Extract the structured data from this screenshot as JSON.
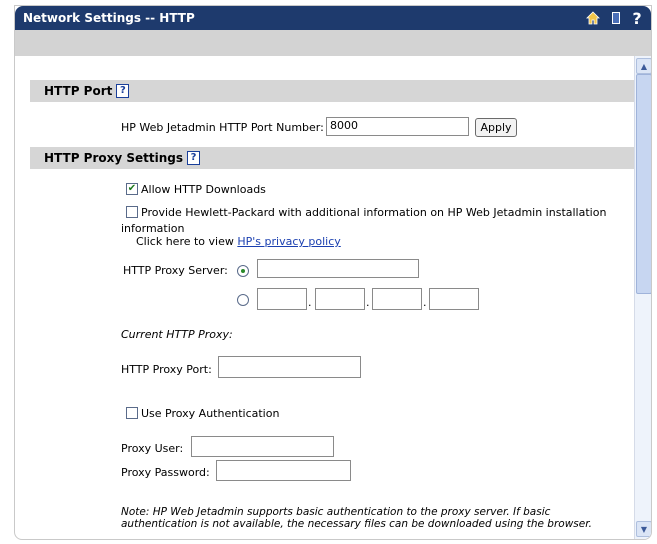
{
  "window": {
    "title": "Network Settings -- HTTP",
    "icons": [
      "home-icon",
      "book-icon",
      "help-icon"
    ],
    "help_glyph": "?"
  },
  "http_port": {
    "heading": "HTTP Port",
    "field_label": "HP Web Jetadmin HTTP Port Number:",
    "field_value": "8000",
    "apply_label": "Apply"
  },
  "proxy": {
    "heading": "HTTP Proxy Settings",
    "allow_downloads_label": "Allow HTTP Downloads",
    "allow_downloads_checked": true,
    "provide_info_label": "Provide Hewlett-Packard with additional information on HP Web Jetadmin installation",
    "provide_info_label_cont": "information",
    "provide_info_checked": false,
    "privacy_prefix": "Click here to view ",
    "privacy_link": "HP's privacy policy",
    "proxy_server_label": "HTTP Proxy Server:",
    "proxy_server_mode": "hostname",
    "proxy_server_value": "",
    "ip_octets": [
      "",
      "",
      "",
      ""
    ],
    "ip_dot": ".",
    "current_proxy_label": "Current HTTP Proxy:",
    "proxy_port_label": "HTTP Proxy Port:",
    "proxy_port_value": "",
    "use_auth_label": "Use Proxy Authentication",
    "use_auth_checked": false,
    "proxy_user_label": "Proxy User:",
    "proxy_user_value": "",
    "proxy_password_label": "Proxy Password:",
    "proxy_password_value": "",
    "note_line1": "Note: HP Web Jetadmin supports basic authentication to the proxy server. If basic",
    "note_line2": "authentication is not available, the necessary files can be downloaded using the browser."
  },
  "colors": {
    "titlebar": "#1e3a6d",
    "section_header": "#d6d6d6",
    "link": "#1a3fb0"
  }
}
